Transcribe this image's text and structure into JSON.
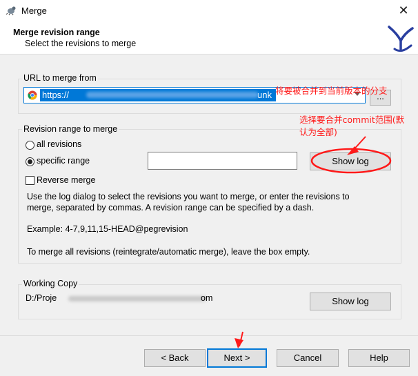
{
  "window": {
    "title": "Merge",
    "close_glyph": "✕"
  },
  "header": {
    "title": "Merge revision range",
    "subtitle": "Select the revisions to merge"
  },
  "url_group": {
    "label": "URL to merge from",
    "url_value": "https://",
    "url_tail": "unk",
    "browse_label": "..."
  },
  "range_group": {
    "label": "Revision range to merge",
    "all_revisions_label": "all revisions",
    "specific_range_label": "specific range",
    "selected": "specific range",
    "range_value": "",
    "show_log_label": "Show log",
    "reverse_merge_label": "Reverse merge",
    "reverse_merge_checked": false,
    "help_line1": "Use the log dialog to select the revisions you want to merge, or enter the revisions to",
    "help_line2": "merge, separated by commas. A revision range can be specified by a dash.",
    "example": "Example: 4-7,9,11,15-HEAD@pegrevision",
    "empty_note": "To merge all revisions (reintegrate/automatic merge), leave the box empty."
  },
  "wc_group": {
    "label": "Working Copy",
    "path_start": "D:/Proje",
    "path_end": "om",
    "show_log_label": "Show log"
  },
  "footer": {
    "back_label": "< Back",
    "next_label": "Next >",
    "cancel_label": "Cancel",
    "help_label": "Help"
  },
  "annotations": {
    "branch_note": "将要被合并到当前版本的分支",
    "commit_note_line1": "选择要合并commit范围(默",
    "commit_note_line2": "认为全部)"
  },
  "colors": {
    "accent": "#0078d7",
    "annotation": "#ff1a1a"
  }
}
